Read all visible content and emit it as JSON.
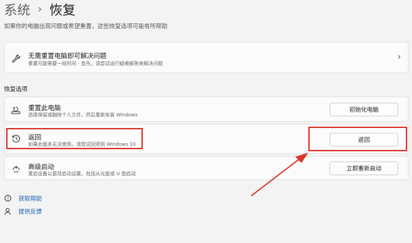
{
  "breadcrumb": {
    "parent": "系统",
    "separator": "›",
    "current": "恢复"
  },
  "description": "如果你的电脑出现问题或希望重置，这些恢复选项可能有所帮助",
  "troubleshoot": {
    "title": "无需重置电脑即可解决问题",
    "subtitle": "重置可能需要一段时间 - 首先，请尝试运行疑难解答来解决问题",
    "icon": "wrench-icon"
  },
  "section_label": "恢复选项",
  "options": [
    {
      "title": "重置此电脑",
      "subtitle": "选择保留或删除个人文件，然后重新安装 Windows",
      "button": "初始化电脑",
      "icon": "reset-pc-icon"
    },
    {
      "title": "返回",
      "subtitle": "如果此版本无法使用，请尝试回退到 Windows 10",
      "button": "返回",
      "icon": "history-icon"
    },
    {
      "title": "高级启动",
      "subtitle": "重启设备以更改启动设置，包括从光盘或 U 盘启动",
      "button": "立即重新启动",
      "icon": "advanced-startup-icon"
    }
  ],
  "links": [
    {
      "label": "获取帮助",
      "icon": "help-icon"
    },
    {
      "label": "提供反馈",
      "icon": "feedback-icon"
    }
  ],
  "annotation_color": "#d9362b",
  "link_color": "#1a5fb4"
}
